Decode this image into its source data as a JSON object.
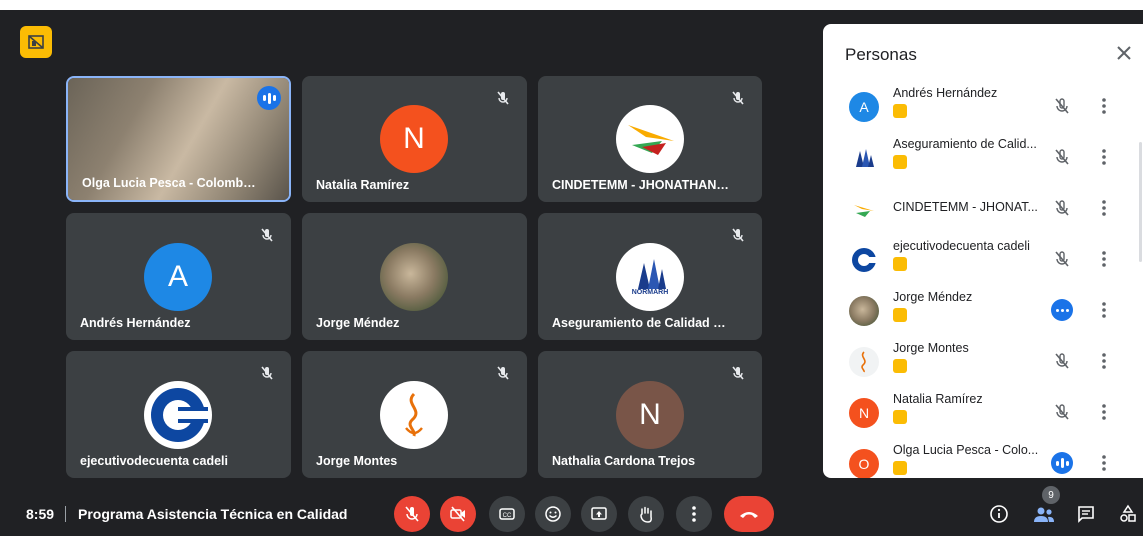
{
  "tiles": [
    {
      "name": "Olga Lucia Pesca - Colombia P..."
    },
    {
      "name": "Natalia Ramírez",
      "initial": "N"
    },
    {
      "name": "CINDETEMM - JHONATHAN T..."
    },
    {
      "name": "Andrés Hernández",
      "initial": "A"
    },
    {
      "name": "Jorge Méndez"
    },
    {
      "name": "Aseguramiento de Calidad Nor...",
      "logo_text": "NORMARH"
    },
    {
      "name": "ejecutivodecuenta cadeli"
    },
    {
      "name": "Jorge Montes"
    },
    {
      "name": "Nathalia Cardona Trejos",
      "initial": "N"
    }
  ],
  "people_panel": {
    "title": "Personas",
    "people": [
      {
        "name": "Andrés Hernández",
        "initial": "A"
      },
      {
        "name": "Aseguramiento de Calid..."
      },
      {
        "name": "CINDETEMM - JHONAT..."
      },
      {
        "name": "ejecutivodecuenta cadeli"
      },
      {
        "name": "Jorge Méndez"
      },
      {
        "name": "Jorge Montes"
      },
      {
        "name": "Natalia Ramírez",
        "initial": "N"
      },
      {
        "name": "Olga Lucia Pesca - Colo...",
        "initial": "O"
      }
    ]
  },
  "bottom_bar": {
    "time": "8:59",
    "meeting_title": "Programa Asistencia Técnica en Calidad",
    "participant_count": "9"
  },
  "colors": {
    "background": "#202124",
    "tile": "#3c4043",
    "accent_blue": "#1a73e8",
    "red": "#ea4335",
    "yellow": "#fbbc04"
  }
}
